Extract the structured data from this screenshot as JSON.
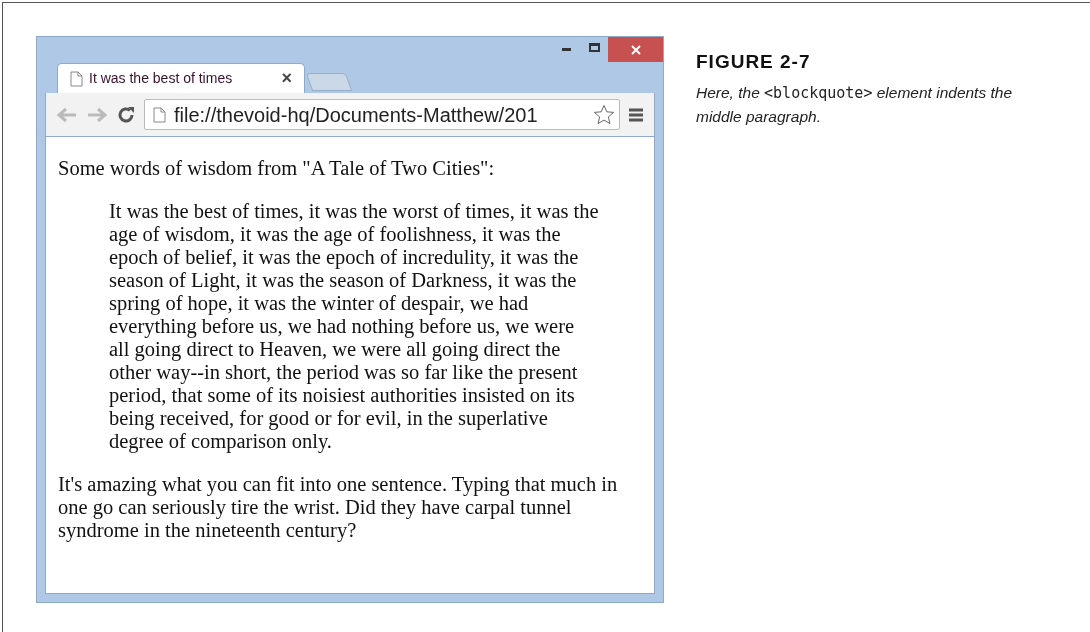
{
  "browser": {
    "tab": {
      "title": "It was the best of times",
      "close": "×"
    },
    "address": "file://thevoid-hq/Documents-Matthew/201",
    "page": {
      "intro": "Some words of wisdom from \"A Tale of Two Cities\":",
      "blockquote": "It was the best of times, it was the worst of times, it was the age of wisdom, it was the age of foolishness, it was the epoch of belief, it was the epoch of incredulity, it was the season of Light, it was the season of Darkness, it was the spring of hope, it was the winter of despair, we had everything before us, we had nothing before us, we were all going direct to Heaven, we were all going direct the other way--in short, the period was so far like the present period, that some of its noisiest authorities insisted on its being received, for good or for evil, in the superlative degree of comparison only.",
      "outro": "It's amazing what you can fit into one sentence. Typing that much in one go can seriously tire the wrist. Did they have carpal tunnel syndrome in the nineteenth century?"
    }
  },
  "figure": {
    "label": "FIGURE 2-7",
    "caption": {
      "before": "Here, the ",
      "code": "<blockquote>",
      "after": " element indents the middle paragraph."
    }
  }
}
